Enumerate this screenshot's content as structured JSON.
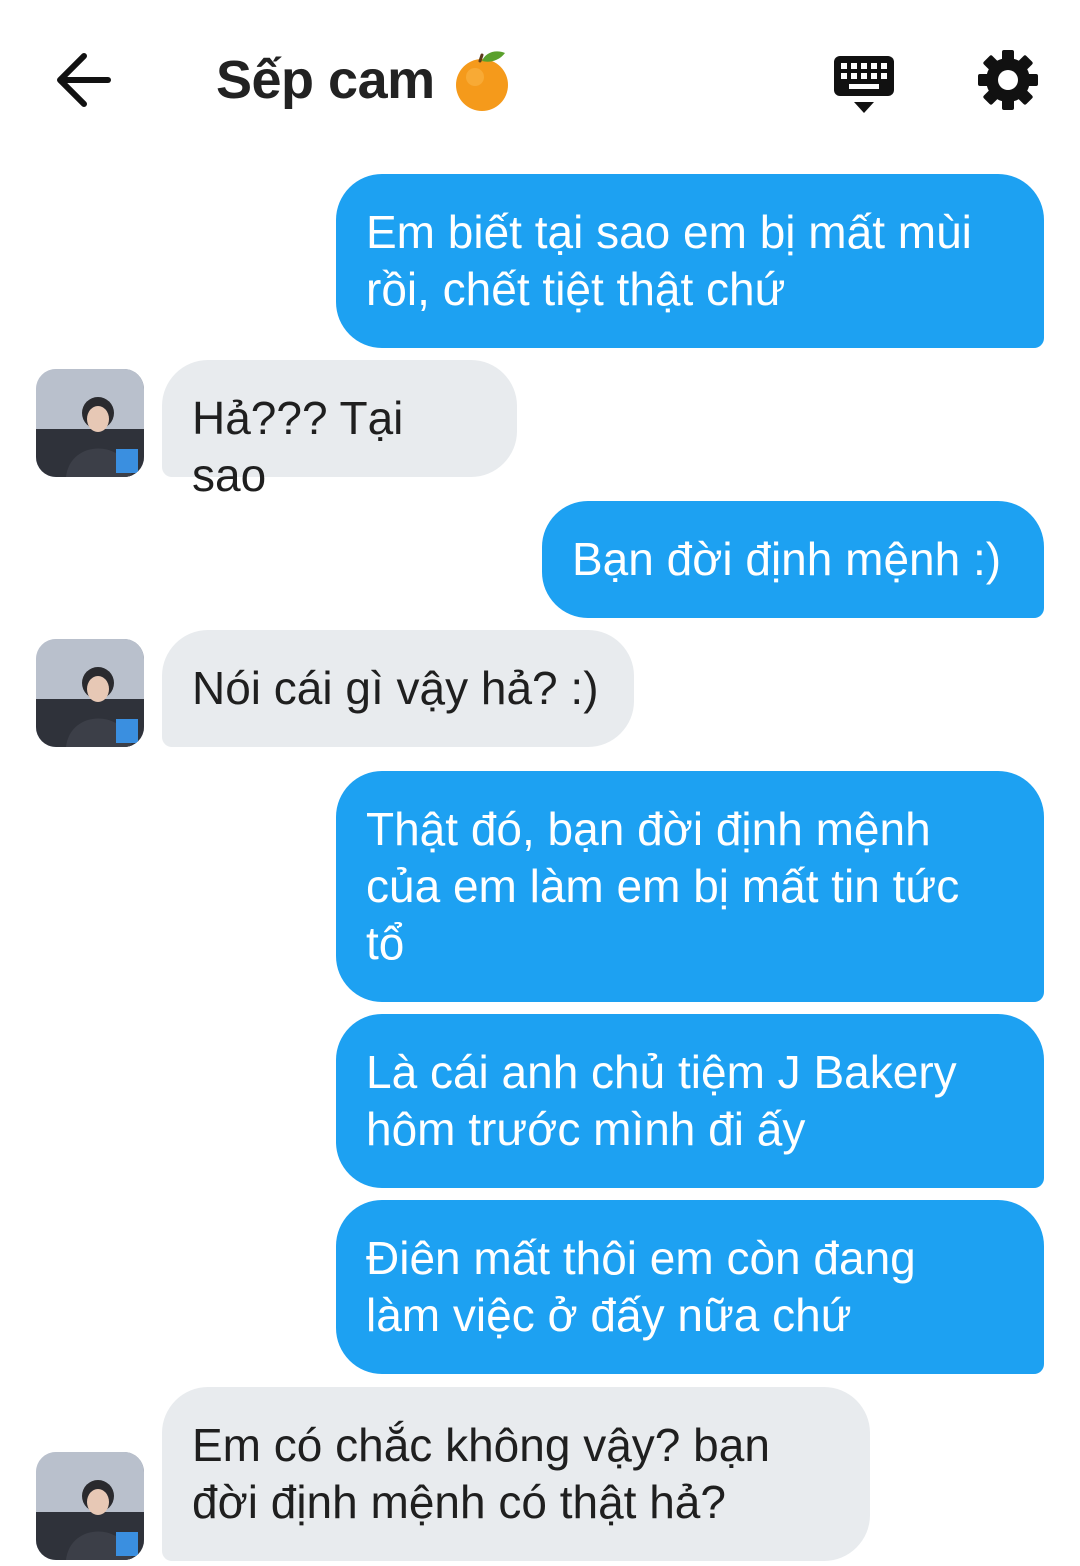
{
  "header": {
    "title": "Sếp cam",
    "title_emoji": "orange-emoji",
    "back_icon": "arrow-left-icon",
    "keyboard_icon": "keyboard-icon",
    "settings_icon": "gear-icon"
  },
  "colors": {
    "outgoing_bubble": "#1da1f2",
    "incoming_bubble": "#e8ebee",
    "header_text": "#222222"
  },
  "messages": [
    {
      "from": "me",
      "text": "Em biết tại sao em bị mất mùi\nrồi, chết tiệt thật chứ"
    },
    {
      "from": "them",
      "text": "Hả??? Tại sao"
    },
    {
      "from": "me",
      "text": "Bạn đời định mệnh :)"
    },
    {
      "from": "them",
      "text": "Nói cái gì vậy hả? :)"
    },
    {
      "from": "me",
      "text": "Thật đó, bạn đời định mệnh\ncủa em làm em bị mất tin tức\ntổ"
    },
    {
      "from": "me",
      "text": "Là cái anh chủ tiệm J Bakery\nhôm trước mình đi ấy"
    },
    {
      "from": "me",
      "text": "Điên mất thôi em còn đang\nlàm việc ở đấy nữa chứ"
    },
    {
      "from": "them",
      "text": "Em có chắc không vậy? bạn\nđời định mệnh có thật hả?"
    }
  ]
}
